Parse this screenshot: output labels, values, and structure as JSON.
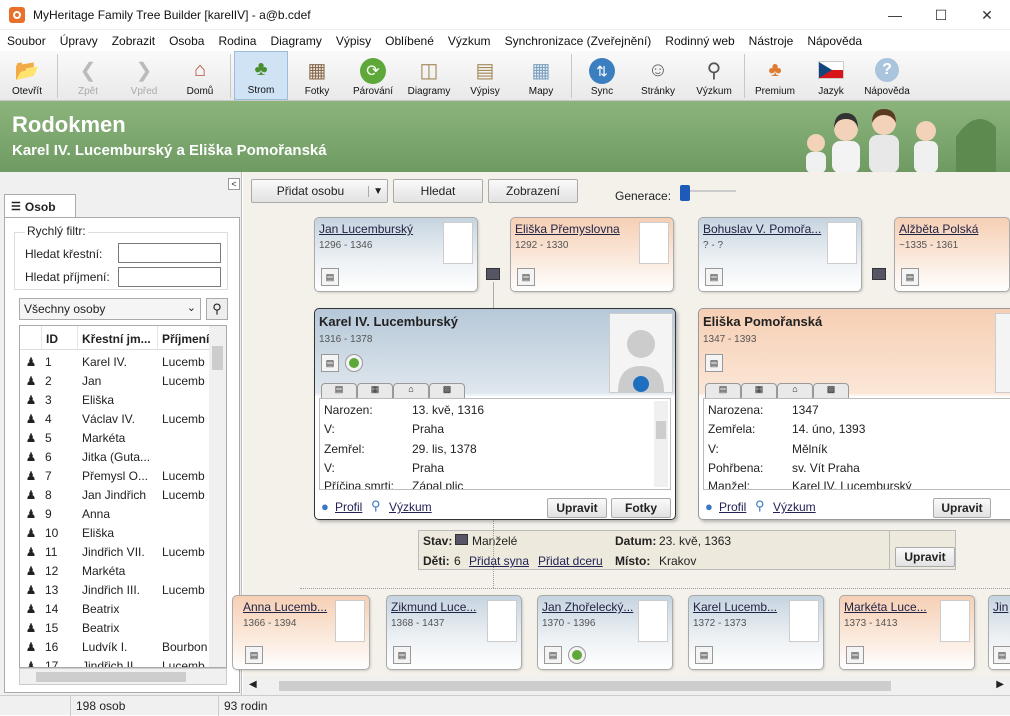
{
  "window": {
    "title": "MyHeritage Family Tree Builder [karelIV] - a@b.cdef"
  },
  "menu": [
    "Soubor",
    "Úpravy",
    "Zobrazit",
    "Osoba",
    "Rodina",
    "Diagramy",
    "Výpisy",
    "Oblíbené",
    "Výzkum",
    "Synchronizace (Zveřejnění)",
    "Rodinný web",
    "Nástroje",
    "Nápověda"
  ],
  "toolbar": {
    "open": "Otevřít",
    "back": "Zpět",
    "forward": "Vpřed",
    "home": "Domů",
    "tree": "Strom",
    "photos": "Fotky",
    "matching": "Párování",
    "diagrams": "Diagramy",
    "reports": "Výpisy",
    "maps": "Mapy",
    "sync": "Sync",
    "pages": "Stránky",
    "research": "Výzkum",
    "premium": "Premium",
    "language": "Jazyk",
    "help": "Nápověda"
  },
  "banner": {
    "title": "Rodokmen",
    "subtitle": "Karel IV. Lucemburský a Eliška Pomořanská"
  },
  "left": {
    "tab": "Osob",
    "filter_legend": "Rychlý filtr:",
    "first_label": "Hledat křestní:",
    "last_label": "Hledat příjmení:",
    "select": "Všechny osoby",
    "cols": {
      "id": "ID",
      "first": "Křestní jm...",
      "last": "Příjmení"
    },
    "rows": [
      {
        "id": "1",
        "first": "Karel IV.",
        "last": "Lucemb"
      },
      {
        "id": "2",
        "first": "Jan",
        "last": "Lucemb"
      },
      {
        "id": "3",
        "first": "Eliška",
        "last": ""
      },
      {
        "id": "4",
        "first": "Václav IV.",
        "last": "Lucemb"
      },
      {
        "id": "5",
        "first": "Markéta",
        "last": ""
      },
      {
        "id": "6",
        "first": "Jitka (Guta...",
        "last": ""
      },
      {
        "id": "7",
        "first": "Přemysl O...",
        "last": "Lucemb"
      },
      {
        "id": "8",
        "first": "Jan Jindřich",
        "last": "Lucemb"
      },
      {
        "id": "9",
        "first": "Anna",
        "last": ""
      },
      {
        "id": "10",
        "first": "Eliška",
        "last": ""
      },
      {
        "id": "11",
        "first": "Jindřich VII.",
        "last": "Lucemb"
      },
      {
        "id": "12",
        "first": "Markéta",
        "last": ""
      },
      {
        "id": "13",
        "first": "Jindřich III.",
        "last": "Lucemb"
      },
      {
        "id": "14",
        "first": "Beatrix",
        "last": ""
      },
      {
        "id": "15",
        "first": "Beatrix",
        "last": ""
      },
      {
        "id": "16",
        "first": "Ludvík I.",
        "last": "Bourbon"
      },
      {
        "id": "17",
        "first": "Jindřich II.",
        "last": "Lucemb"
      }
    ]
  },
  "main": {
    "add_person": "Přidat osobu",
    "search": "Hledat",
    "view": "Zobrazení",
    "generations": "Generace:",
    "parents": [
      {
        "name": "Jan Lucemburský",
        "dates": "1296 - 1346"
      },
      {
        "name": "Eliška Přemyslovna",
        "dates": "1292 - 1330"
      },
      {
        "name": "Bohuslav V. Pomořa...",
        "dates": "? - ?"
      },
      {
        "name": "Alžběta Polská",
        "dates": "~1335 - 1361"
      }
    ],
    "husband": {
      "name": "Karel IV. Lucemburský",
      "dates": "1316 - 1378",
      "born_l": "Narozen:",
      "born_v": "13. kvě, 1316",
      "place1_l": "V:",
      "place1_v": "Praha",
      "died_l": "Zemřel:",
      "died_v": "29. lis, 1378",
      "place2_l": "V:",
      "place2_v": "Praha",
      "cause_l": "Příčina smrti:",
      "cause_v": "Zápal plic",
      "profile": "Profil",
      "research": "Výzkum",
      "edit": "Upravit",
      "photos": "Fotky"
    },
    "wife": {
      "name": "Eliška Pomořanská",
      "dates": "1347 - 1393",
      "born_l": "Narozena:",
      "born_v": "1347",
      "died_l": "Zemřela:",
      "died_v": "14. úno, 1393",
      "place_l": "V:",
      "place_v": "Mělník",
      "buried_l": "Pohřbena:",
      "buried_v": "sv. Vít Praha",
      "spouse_l": "Manžel:",
      "spouse_v": "Karel IV. Lucemburský",
      "profile": "Profil",
      "research": "Výzkum",
      "edit": "Upravit"
    },
    "family": {
      "status_l": "Stav:",
      "status_v": "Manželé",
      "date_l": "Datum:",
      "date_v": "23. kvě, 1363",
      "children_l": "Děti:",
      "children_v": "6",
      "add_son": "Přidat syna",
      "add_daughter": "Přidat dceru",
      "place_l": "Místo:",
      "place_v": "Krakov",
      "edit": "Upravit"
    },
    "children": [
      {
        "name": "Anna Lucemb...",
        "dates": "1366 - 1394"
      },
      {
        "name": "Zikmund Luce...",
        "dates": "1368 - 1437"
      },
      {
        "name": "Jan Zhořelecký...",
        "dates": "1370 - 1396"
      },
      {
        "name": "Karel Lucemb...",
        "dates": "1372 - 1373"
      },
      {
        "name": "Markéta Luce...",
        "dates": "1373 - 1413"
      },
      {
        "name": "Jin",
        "dates": ""
      }
    ]
  },
  "status": {
    "persons": "198 osob",
    "families": "93 rodin"
  }
}
